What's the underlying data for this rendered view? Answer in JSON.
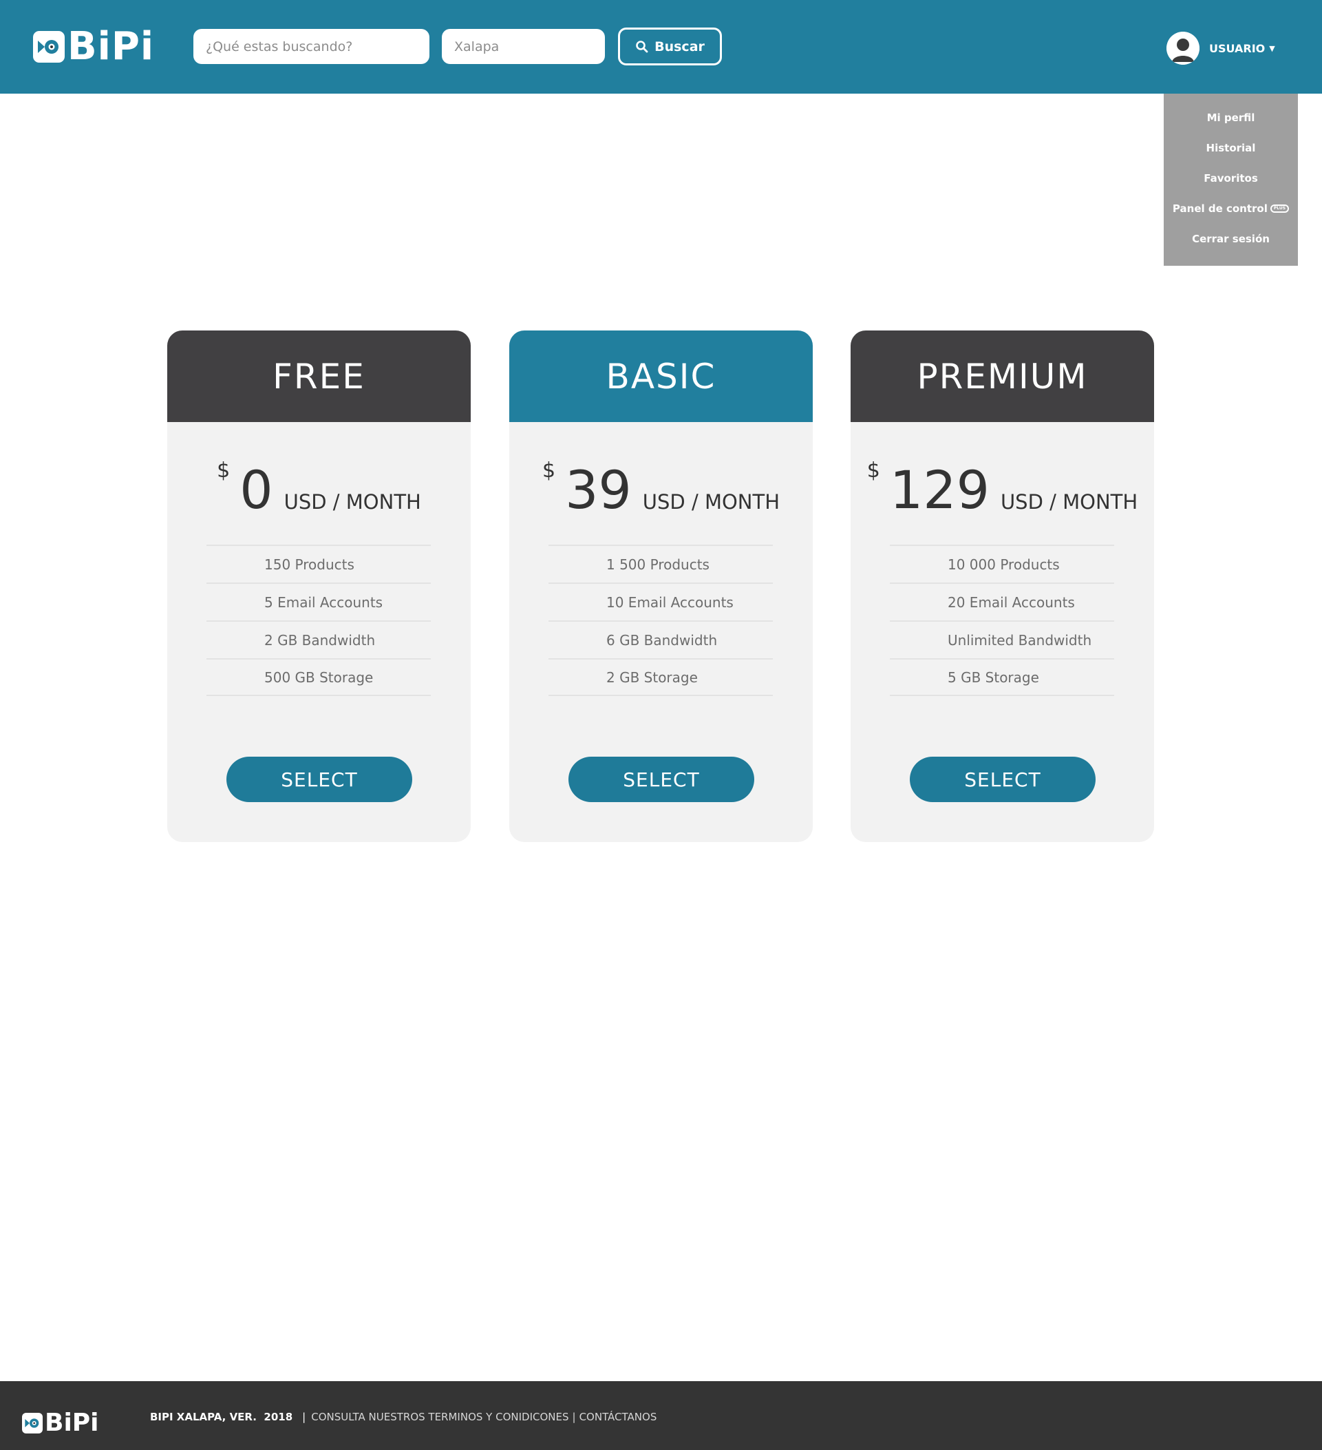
{
  "colors": {
    "header": "#217f9e",
    "accent": "#1f7b99",
    "dark": "#414042",
    "dropdown": "#9f9f9f",
    "footer": "#343434"
  },
  "header": {
    "logo": "BiPi",
    "search": {
      "placeholder": "¿Qué estas buscando?",
      "value": ""
    },
    "location": {
      "placeholder": "Xalapa",
      "value": ""
    },
    "search_button": {
      "label": "Buscar",
      "icon": "search-icon"
    },
    "user": {
      "label": "USUARIO",
      "icon": "avatar-icon"
    }
  },
  "user_menu": {
    "items": [
      {
        "label": "Mi perfil"
      },
      {
        "label": "Historial"
      },
      {
        "label": "Favoritos"
      },
      {
        "label": "Panel de control",
        "badge": "PLUS"
      },
      {
        "label": "Cerrar sesión"
      }
    ]
  },
  "plans": [
    {
      "name": "FREE",
      "currency": "$",
      "price": "0",
      "period": "USD / MONTH",
      "features": [
        "150 Products",
        "5 Email Accounts",
        "2 GB Bandwidth",
        "500 GB Storage"
      ],
      "button": "SELECT",
      "header_color": "#414042"
    },
    {
      "name": "BASIC",
      "currency": "$",
      "price": "39",
      "period": "USD / MONTH",
      "features": [
        "1 500 Products",
        "10 Email Accounts",
        "6 GB Bandwidth",
        "2 GB Storage"
      ],
      "button": "SELECT",
      "header_color": "#217f9e"
    },
    {
      "name": "PREMIUM",
      "currency": "$",
      "price": "129",
      "period": "USD / MONTH",
      "features": [
        "10 000 Products",
        "20 Email Accounts",
        "Unlimited Bandwidth",
        "5 GB Storage"
      ],
      "button": "SELECT",
      "header_color": "#414042"
    }
  ],
  "footer": {
    "logo": "BiPi",
    "brand": "BIPI XALAPA, VER.  2018",
    "separator": "|",
    "terms_link": "CONSULTA NUESTROS TERMINOS Y CONIDICONES",
    "divider": "|",
    "contact_link": "CONTÁCTANOS"
  }
}
